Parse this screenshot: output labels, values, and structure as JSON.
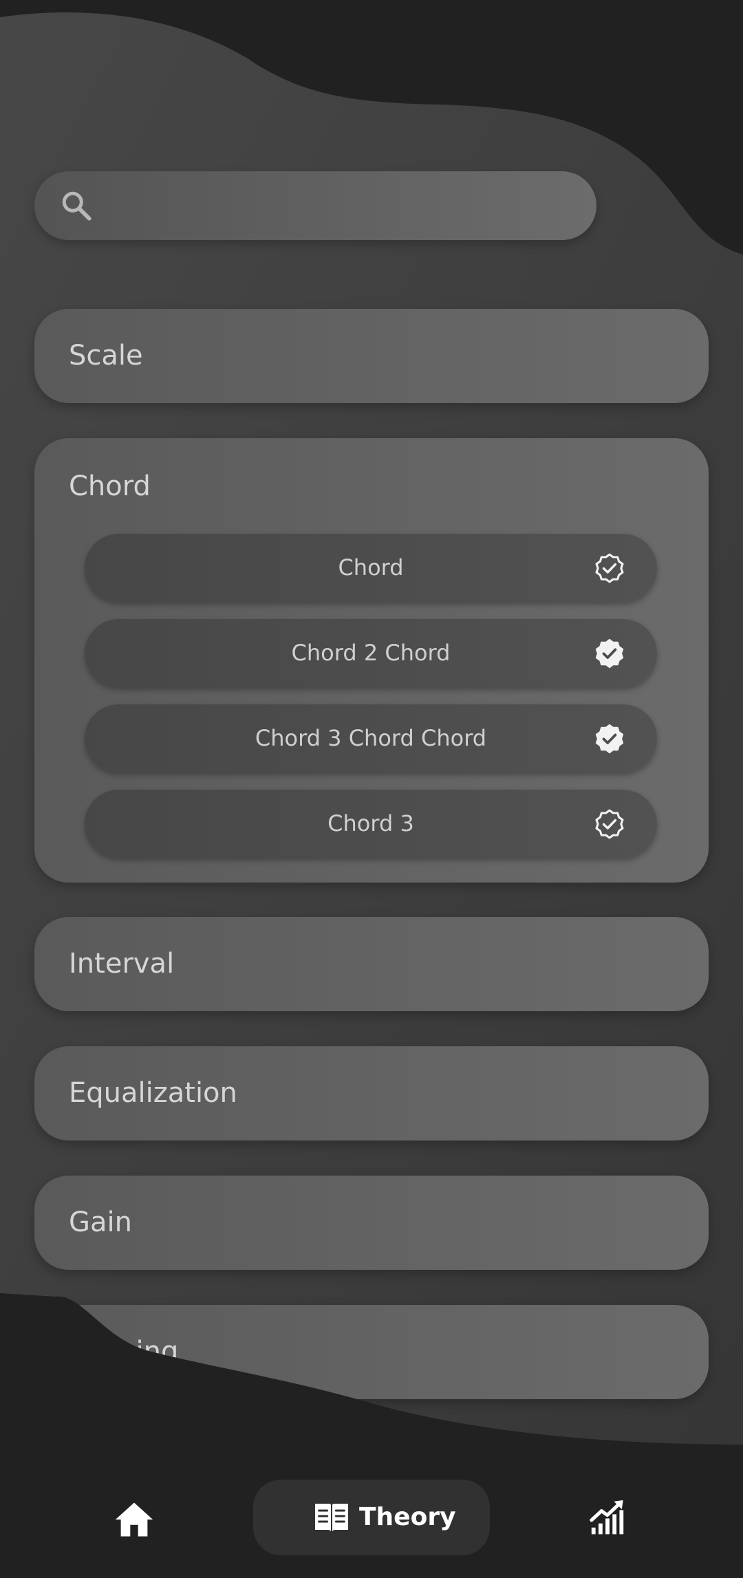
{
  "search": {
    "placeholder": "",
    "icon": "search-icon"
  },
  "categories": [
    {
      "title": "Scale",
      "expanded": false
    },
    {
      "title": "Chord",
      "expanded": true,
      "items": [
        {
          "label": "Chord",
          "status": "verified-outline"
        },
        {
          "label": "Chord 2 Chord",
          "status": "verified-filled"
        },
        {
          "label": "Chord 3 Chord Chord",
          "status": "verified-filled"
        },
        {
          "label": "Chord 3",
          "status": "verified-outline"
        }
      ]
    },
    {
      "title": "Interval",
      "expanded": false
    },
    {
      "title": "Equalization",
      "expanded": false
    },
    {
      "title": "Gain",
      "expanded": false
    },
    {
      "title": "Panning",
      "expanded": false
    }
  ],
  "nav": {
    "items": [
      {
        "icon": "home-icon",
        "label": ""
      },
      {
        "icon": "book-icon",
        "label": "Theory",
        "active": true
      },
      {
        "icon": "stats-icon",
        "label": ""
      }
    ]
  },
  "colors": {
    "background": "#212121",
    "blob": "#3c3c3c",
    "card": "#636363",
    "sub_item": "#4c4c4c",
    "text": "#d6d6d6",
    "nav_active": "#313131"
  }
}
